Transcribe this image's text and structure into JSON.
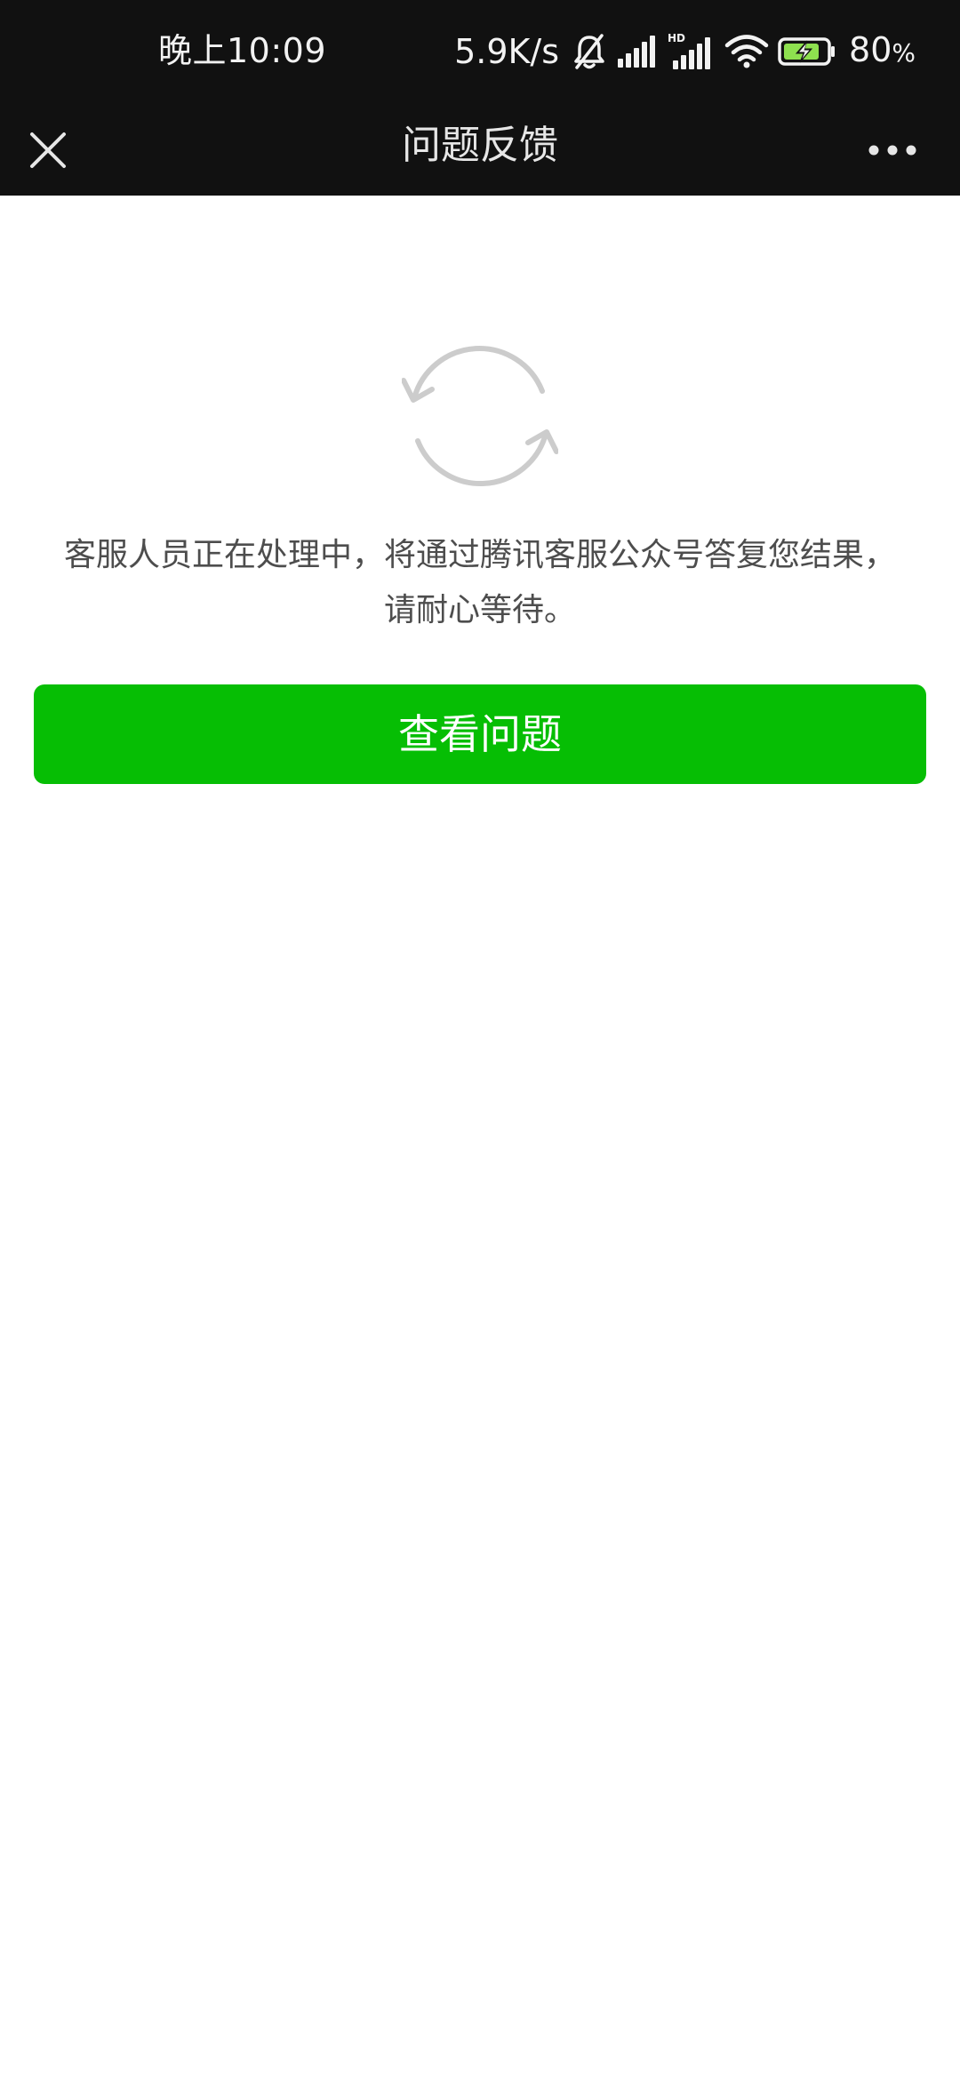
{
  "status_bar": {
    "time": "晚上10:09",
    "net_speed": "5.9K/s",
    "battery_value": "80",
    "battery_unit": "%"
  },
  "title_bar": {
    "title": "问题反馈",
    "close_icon": "close-icon",
    "more_icon": "more-dots-icon"
  },
  "main": {
    "status_icon": "refresh-icon",
    "message_line1": "客服人员正在处理中，将通过腾讯客服公众号答复您结果，",
    "message_line2": "请耐心等待。",
    "view_button_label": "查看问题"
  },
  "colors": {
    "header_bg": "#111111",
    "primary_button": "#06be04",
    "text_gray": "#4d4d4d",
    "icon_gray": "#c8c8c8"
  }
}
